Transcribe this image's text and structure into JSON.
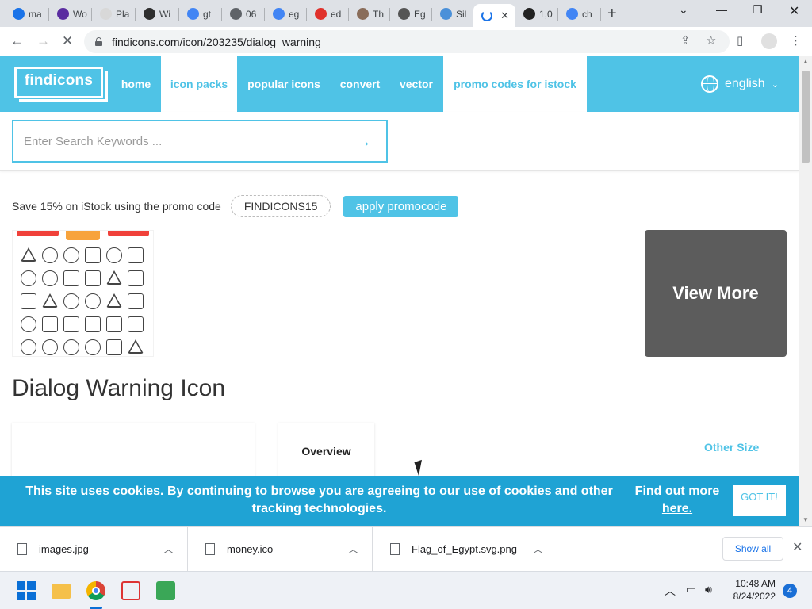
{
  "browser": {
    "tabs": [
      {
        "label": "ma",
        "icon": "c-logo-icon",
        "color": "#1a73e8"
      },
      {
        "label": "Wo",
        "icon": "circle-logo-icon",
        "color": "#5a2ca0"
      },
      {
        "label": "Pla",
        "icon": "s-logo-icon",
        "color": "#d8d8d8"
      },
      {
        "label": "Wi",
        "icon": "robot-icon",
        "color": "#2e2e2e"
      },
      {
        "label": "gt",
        "icon": "google-icon",
        "color": "#4285f4"
      },
      {
        "label": "06",
        "icon": "globe-icon",
        "color": "#5f6368"
      },
      {
        "label": "eg",
        "icon": "google-icon",
        "color": "#4285f4"
      },
      {
        "label": "ed",
        "icon": "edit-logo-icon",
        "color": "#e0312b"
      },
      {
        "label": "Th",
        "icon": "portrait-icon",
        "color": "#8a6d5a"
      },
      {
        "label": "Eg",
        "icon": "wikipedia-icon",
        "color": "#555"
      },
      {
        "label": "Sil",
        "icon": "doc-icon",
        "color": "#4a90d9"
      },
      {
        "label": "",
        "icon": "loading-spinner-icon",
        "color": "#1a73e8",
        "active": true
      },
      {
        "label": "1,0",
        "icon": "s-square-icon",
        "color": "#222"
      },
      {
        "label": "ch",
        "icon": "google-icon",
        "color": "#4285f4"
      }
    ],
    "url": "findicons.com/icon/203235/dialog_warning"
  },
  "site": {
    "logo_text": "findicons",
    "nav": [
      {
        "label": "home",
        "style": "blue"
      },
      {
        "label": "icon packs",
        "style": "light"
      },
      {
        "label": "popular icons",
        "style": "blue"
      },
      {
        "label": "convert",
        "style": "blue"
      },
      {
        "label": "vector",
        "style": "blue"
      },
      {
        "label": "promo codes for istock",
        "style": "light"
      }
    ],
    "language": "english",
    "search_placeholder": "Enter Search Keywords ...",
    "promo_text": "Save 15% on iStock using the promo code",
    "promo_code": "FINDICONS15",
    "promo_button": "apply promocode",
    "view_more": "View More",
    "page_title": "Dialog Warning Icon",
    "tab_overview": "Overview",
    "tab_other": "Other Size"
  },
  "cookie": {
    "message": "This site uses cookies. By continuing to browse you are agreeing to our use of cookies and other tracking technologies.",
    "link": "Find out more here.",
    "button": "GOT IT!"
  },
  "downloads": {
    "items": [
      "images.jpg",
      "money.ico",
      "Flag_of_Egypt.svg.png"
    ],
    "show_all": "Show all"
  },
  "taskbar": {
    "time": "10:48 AM",
    "date": "8/24/2022",
    "notifications": "4"
  },
  "colors": {
    "brand": "#4fc3e6",
    "cookie_bar": "#1fa3d4",
    "view_more_bg": "#5c5c5c"
  }
}
